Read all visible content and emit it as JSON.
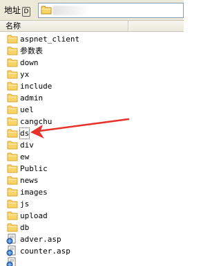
{
  "address_bar": {
    "label": "地址",
    "hotkey": "D"
  },
  "columns": {
    "name": "名称"
  },
  "files": [
    {
      "name": "aspnet_client",
      "type": "folder"
    },
    {
      "name": "参数表",
      "type": "folder"
    },
    {
      "name": "down",
      "type": "folder"
    },
    {
      "name": "yx",
      "type": "folder"
    },
    {
      "name": "include",
      "type": "folder"
    },
    {
      "name": "admin",
      "type": "folder"
    },
    {
      "name": "uel",
      "type": "folder"
    },
    {
      "name": "cangchu",
      "type": "folder"
    },
    {
      "name": "ds",
      "type": "folder",
      "selected": true
    },
    {
      "name": "div",
      "type": "folder"
    },
    {
      "name": "ew",
      "type": "folder"
    },
    {
      "name": "Public",
      "type": "folder"
    },
    {
      "name": "news",
      "type": "folder"
    },
    {
      "name": "images",
      "type": "folder"
    },
    {
      "name": "js",
      "type": "folder"
    },
    {
      "name": "upload",
      "type": "folder"
    },
    {
      "name": "db",
      "type": "folder"
    },
    {
      "name": "adver.asp",
      "type": "asp-file"
    },
    {
      "name": "counter.asp",
      "type": "asp-file"
    },
    {
      "name": "",
      "type": "asp-file"
    }
  ],
  "colors": {
    "folder": "#f7d46a",
    "folder_dark": "#d8a428",
    "arrow": "#e8332b"
  }
}
